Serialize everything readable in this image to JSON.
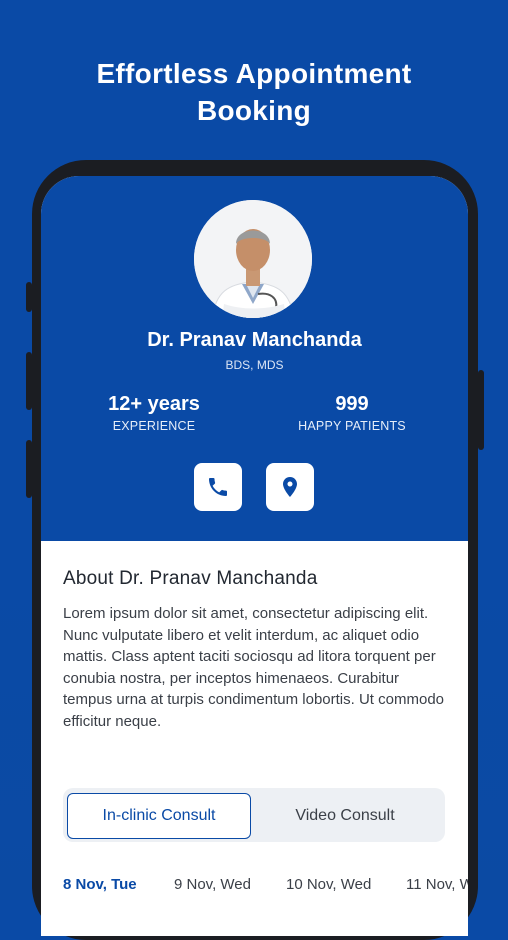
{
  "promo": {
    "title_line1": "Effortless Appointment",
    "title_line2": "Booking"
  },
  "doctor": {
    "name": "Dr. Pranav Manchanda",
    "degree": "BDS, MDS",
    "stats": [
      {
        "value": "12+ years",
        "label": "EXPERIENCE"
      },
      {
        "value": "999",
        "label": "HAPPY PATIENTS"
      }
    ],
    "actions": [
      {
        "icon": "phone-icon"
      },
      {
        "icon": "location-pin-icon"
      }
    ]
  },
  "about": {
    "title": "About Dr. Pranav Manchanda",
    "text": "Lorem ipsum dolor sit amet, consectetur adipiscing elit. Nunc vulputate libero et velit interdum, ac aliquet odio mattis. Class aptent taciti sociosqu ad litora torquent per conubia nostra, per inceptos himenaeos. Curabitur tempus urna at turpis condimentum lobortis. Ut commodo efficitur neque."
  },
  "consult_tabs": {
    "selected": "In-clinic Consult",
    "other": "Video Consult"
  },
  "dates": [
    "8 Nov, Tue",
    "9 Nov, Wed",
    "10 Nov, Wed",
    "11 Nov, W"
  ],
  "colors": {
    "brand": "#0a4aa6",
    "background": "#ffffff",
    "frame": "#1b1d22"
  }
}
